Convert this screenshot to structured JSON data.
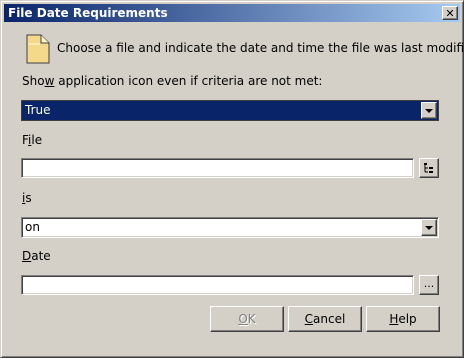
{
  "window": {
    "title": "File Date Requirements",
    "close_label": "✕"
  },
  "intro": {
    "text": "Choose a file and indicate the date and time the file was last modified."
  },
  "show_icon": {
    "label": "Show application icon even if criteria are not met:",
    "value": "True"
  },
  "file": {
    "label": "File",
    "value": "",
    "browse_icon": "tree-browse-icon"
  },
  "is": {
    "label": "is",
    "value": "on"
  },
  "date": {
    "label": "Date",
    "value": "",
    "picker_label": "..."
  },
  "buttons": {
    "ok": "OK",
    "cancel": "Cancel",
    "help": "Help"
  },
  "colors": {
    "title_start": "#0a246a",
    "title_end": "#a6caf0",
    "face": "#d4d0c8",
    "selection": "#0a246a"
  }
}
